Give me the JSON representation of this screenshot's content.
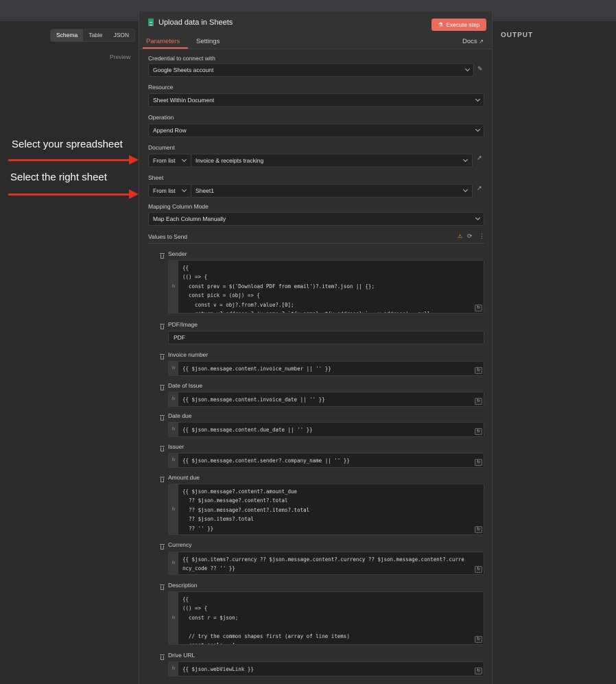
{
  "view_tabs": [
    "Schema",
    "Table",
    "JSON"
  ],
  "preview_label": "Preview",
  "output_label": "OUTPUT",
  "annotations": {
    "spreadsheet": "Select your spreadsheet",
    "sheet": "Select the right sheet"
  },
  "panel": {
    "title": "Upload data in Sheets",
    "execute_label": "Execute step",
    "tabs": [
      "Parameters",
      "Settings"
    ],
    "docs_label": "Docs"
  },
  "credential": {
    "label": "Credential to connect with",
    "value": "Google Sheets account"
  },
  "resource": {
    "label": "Resource",
    "value": "Sheet Within Document"
  },
  "operation": {
    "label": "Operation",
    "value": "Append Row"
  },
  "document": {
    "label": "Document",
    "mode": "From list",
    "value": "Invoice & receipts tracking"
  },
  "sheet": {
    "label": "Sheet",
    "mode": "From list",
    "value": "Sheet1"
  },
  "mapping": {
    "label": "Mapping Column Mode",
    "value": "Map Each Column Manually"
  },
  "values_label": "Values to Send",
  "fields": {
    "sender": {
      "label": "Sender",
      "code": "{{\n(() => {\n  const prev = $('Download PDF from email')?.item?.json || {};\n  const pick = (obj) => {\n    const v = obj?.from?.value?.[0];\n    return v? address ? (v.name ? `${v.name} <${v.address}>` : v.address) : null;"
    },
    "pdf": {
      "label": "PDF/Image",
      "value": "PDF"
    },
    "invoice_number": {
      "label": "Invoice number",
      "code": "{{ $json.message.content.invoice_number || '' }}"
    },
    "date_issue": {
      "label": "Date of Issue",
      "code": "{{ $json.message.content.invoice_date || '' }}"
    },
    "date_due": {
      "label": "Date due",
      "code": "{{ $json.message.content.due_date || '' }}"
    },
    "issuer": {
      "label": "Issuer",
      "code": "{{ $json.message.content.sender?.company_name || '' }}"
    },
    "amount_due": {
      "label": "Amount due",
      "code": "{{ $json.message?.content?.amount_due\n  ?? $json.message?.content?.total\n  ?? $json.message?.content?.items?.total\n  ?? $json.items?.total\n  ?? '' }}"
    },
    "currency": {
      "label": "Currency",
      "code": "{{ $json.items?.currency ?? $json.message.content?.currency ?? $json.message.content?.curre\nncy_code ?? '' }}"
    },
    "description": {
      "label": "Description",
      "code": "{{\n(() => {\n  const r = $json;\n\n  // try the common shapes first (array of line items)\n  const pools = ["
    },
    "drive_url": {
      "label": "Drive URL",
      "code": "{{ $json.webViewLink }}"
    }
  }
}
